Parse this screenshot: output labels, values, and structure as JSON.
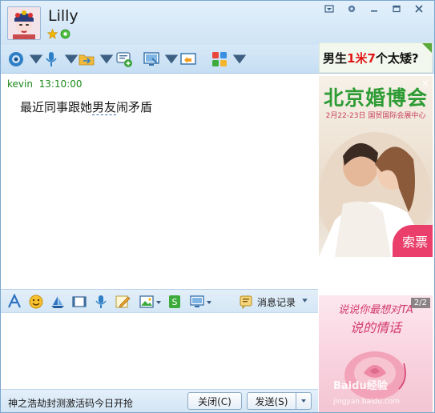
{
  "window": {
    "contact_name": "Lilly",
    "icons": [
      "star-icon",
      "qzone-icon"
    ],
    "controls": [
      "skin-icon",
      "dropdown-icon",
      "minimize-icon",
      "maximize-icon",
      "close-icon"
    ]
  },
  "toolbar": {
    "items": [
      "video-call-icon",
      "voice-call-icon",
      "file-transfer-icon",
      "remote-assist-icon",
      "screen-share-icon",
      "share-screen-icon",
      "apps-icon"
    ]
  },
  "chat": {
    "sender": "kevin",
    "time": "13:10:00",
    "message_part1": "最近同事跟她",
    "message_part2": "男友",
    "message_part3": "闹矛盾"
  },
  "ads": {
    "top_text_a": "男生",
    "top_text_b": "1米7",
    "top_text_c": "个太矮?",
    "main_title": "北京婚博会",
    "main_subtitle": "2月22-23日  国贸国际会展中心",
    "main_ticket": "索票",
    "main_close": "×",
    "bottom_page": "2/2",
    "bottom_line1": "说说你最想对TA",
    "bottom_line2": "说的情话"
  },
  "input_toolbar": {
    "history_label": "消息记录"
  },
  "bottom": {
    "notice": "神之浩劫封测激活码今日开抢",
    "close_label": "关闭(C)",
    "send_label": "发送(S)"
  },
  "watermark": {
    "line1": "Baidu经验",
    "line2": "jingyan.baidu.com"
  },
  "colors": {
    "accent": "#2e9c35",
    "sender_color": "#1d8a1d",
    "ad_pink": "#e93f6a"
  }
}
